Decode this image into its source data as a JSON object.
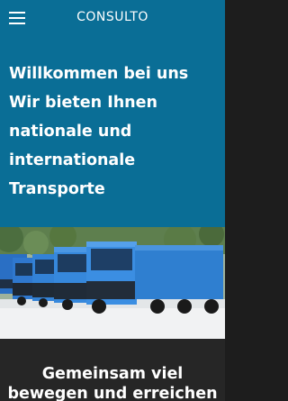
{
  "header": {
    "brand": "CONSULTO",
    "menu_icon": "hamburger-menu-icon",
    "background_color": "#0a6e96"
  },
  "hero": {
    "lines": [
      "Willkommen bei uns",
      "Wir bieten Ihnen",
      "nationale und",
      "internationale",
      "Transporte"
    ]
  },
  "photo": {
    "subject": "truck-fleet-image"
  },
  "section": {
    "lines": [
      "Gemeinsam viel",
      "bewegen und erreichen"
    ],
    "background_color": "#262626"
  }
}
